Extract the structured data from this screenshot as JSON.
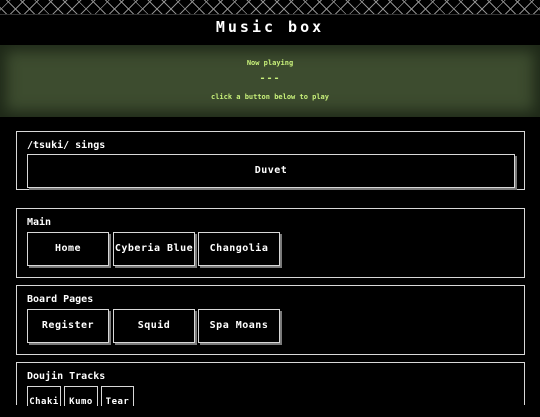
{
  "page": {
    "title": "Music box"
  },
  "now_playing": {
    "label": "Now playing",
    "track": "---",
    "hint": "click a button below to play"
  },
  "sections": [
    {
      "title": "/tsuki/ sings",
      "buttons": [
        "Duvet"
      ]
    },
    {
      "title": "Main",
      "buttons": [
        "Home",
        "Cyberia Blue",
        "Changolia"
      ]
    },
    {
      "title": "Board Pages",
      "buttons": [
        "Register",
        "Squid",
        "Spa Moans"
      ]
    },
    {
      "title": "Doujin Tracks",
      "buttons": [
        "Chaki",
        "Kumo",
        "Tear"
      ]
    }
  ],
  "colors": {
    "background": "#000000",
    "panel": "#3d4c2f",
    "panel_text": "#c8f07a",
    "border": "#d8d8d8"
  }
}
